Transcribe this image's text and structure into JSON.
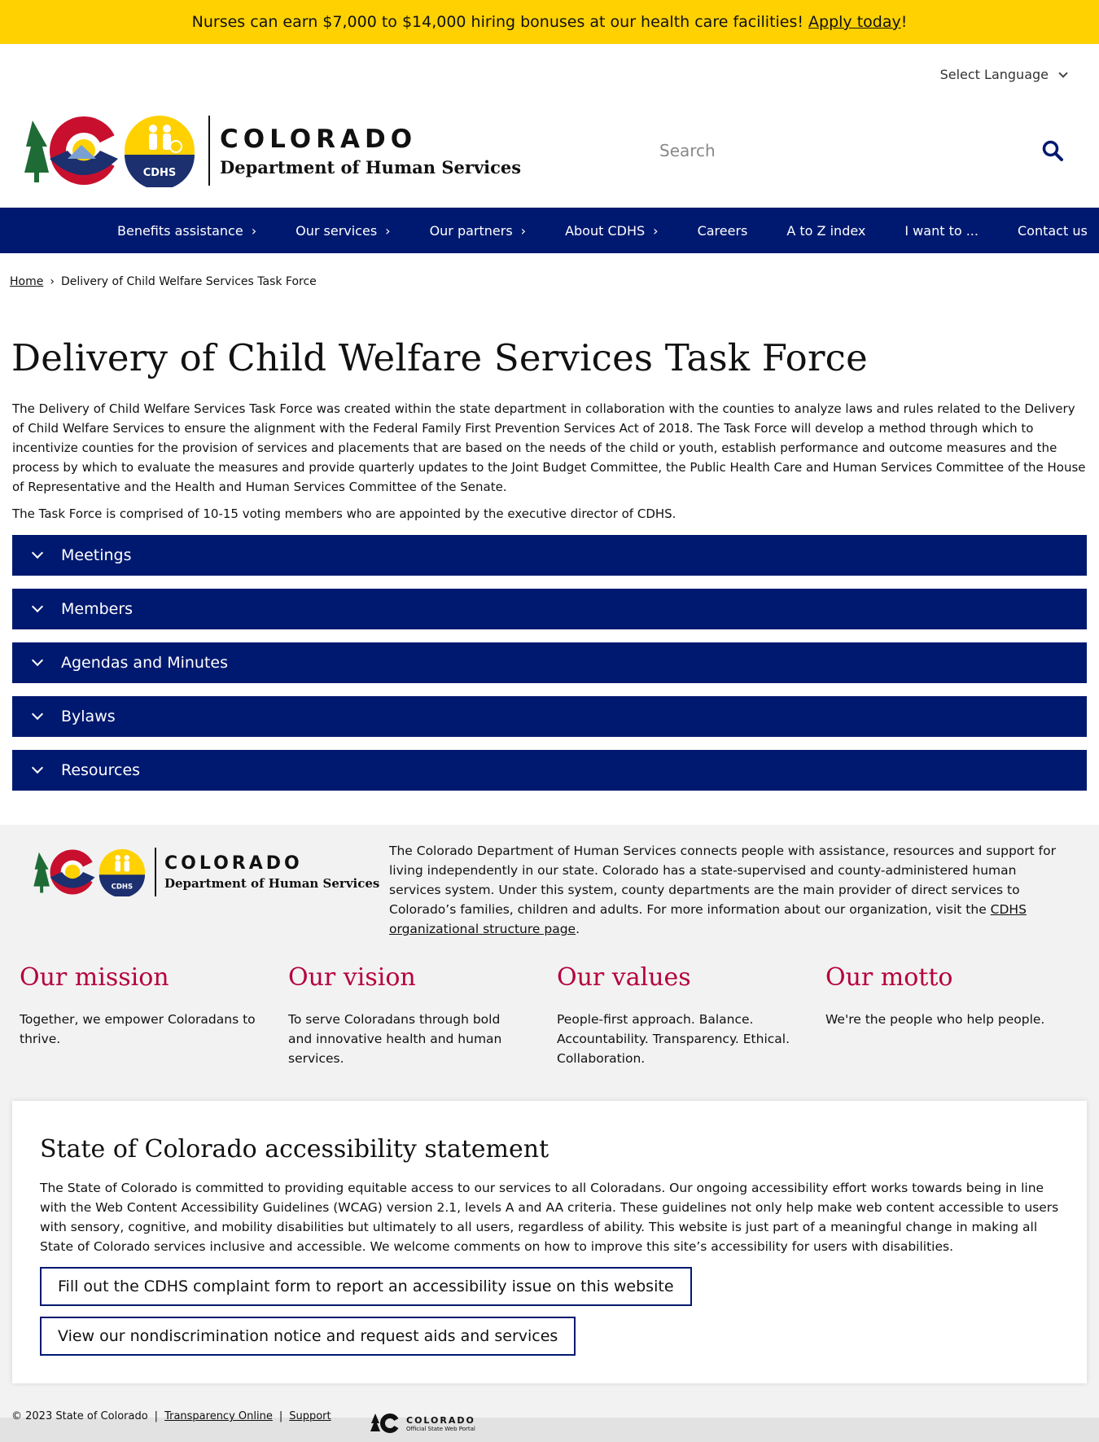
{
  "colors": {
    "alert": "#FFD100",
    "nav": "#001970",
    "accent_red": "#b5003c",
    "footer_bg": "#f2f2f2"
  },
  "alert": {
    "text": "Nurses can earn $7,000 to $14,000 hiring bonuses at our health care facilities!",
    "link": "Apply today",
    "suffix": "!"
  },
  "language": {
    "label": "Select Language"
  },
  "logo": {
    "state": "COLORADO",
    "dept": "Department of Human Services",
    "badge": "CDHS"
  },
  "search": {
    "placeholder": "Search",
    "icon": "search-icon"
  },
  "nav": {
    "items": [
      {
        "label": "Benefits assistance",
        "arrow": "›"
      },
      {
        "label": "Our services",
        "arrow": "›"
      },
      {
        "label": "Our partners",
        "arrow": "›"
      },
      {
        "label": "About CDHS",
        "arrow": "›"
      },
      {
        "label": "Careers"
      },
      {
        "label": "A to Z index"
      },
      {
        "label": "I want to ..."
      },
      {
        "label": "Contact us"
      }
    ]
  },
  "breadcrumb": {
    "home": "Home",
    "sep": "›",
    "current": "Delivery of Child Welfare Services Task Force"
  },
  "page": {
    "title": "Delivery of Child Welfare Services Task Force",
    "intro": "The Delivery of Child Welfare Services Task Force was created within the state department in collaboration with the counties to analyze laws and rules related to the Delivery of Child Welfare Services to ensure the alignment with the Federal Family First Prevention Services Act of 2018. The Task Force will develop a method through which to incentivize counties for the provision of services and placements that are based on the needs of the child or youth, establish performance and outcome measures and the process by which to evaluate the measures and provide quarterly updates to the Joint Budget Committee, the Public Health Care and Human Services Committee of the House of Representative and the Health and Human Services Committee of the Senate.",
    "intro2": "The Task Force is comprised of 10-15 voting members who are appointed by the executive director of CDHS."
  },
  "accordions": [
    "Meetings",
    "Members",
    "Agendas and Minutes",
    "Bylaws",
    "Resources"
  ],
  "footer": {
    "about_text": "The Colorado Department of Human Services connects people with assistance, resources and support for living independently in our state. Colorado has a state-supervised and county-administered human services system. Under this system, county departments are the main provider of direct services to Colorado’s families, children and adults. For more information about our organization, visit the",
    "about_link": "CDHS organizational structure page",
    "about_end": ".",
    "pillars": [
      {
        "title": "Our mission",
        "text": "Together, we empower Coloradans to thrive."
      },
      {
        "title": "Our vision",
        "text": "To serve Coloradans through bold and innovative health and human services."
      },
      {
        "title": "Our values",
        "text": "People-first approach. Balance. Accountability. Transparency. Ethical. Collaboration."
      },
      {
        "title": "Our motto",
        "text": "We're the people who help people."
      }
    ]
  },
  "accessibility": {
    "title": "State of Colorado accessibility statement",
    "text": "The State of Colorado is committed to providing equitable access to our services to all Coloradans. Our ongoing accessibility effort works towards being in line with the Web Content Accessibility Guidelines (WCAG) version 2.1, levels A and AA criteria. These guidelines not only help make web content accessible to users with sensory, cognitive, and mobility disabilities but ultimately to all users, regardless of ability. This website is just part of a meaningful change in making all State of Colorado services inclusive and accessible. We welcome comments on how to improve this site’s accessibility for users with disabilities.",
    "button1": "Fill out the CDHS complaint form to report an accessibility issue on this website",
    "button2": "View our nondiscrimination notice and request aids and services"
  },
  "bottom": {
    "copyright": "© 2023 State of Colorado",
    "sep": "|",
    "link1": "Transparency Online",
    "link2": "Support",
    "portal_title": "COLORADO",
    "portal_sub": "Official State Web Portal"
  }
}
